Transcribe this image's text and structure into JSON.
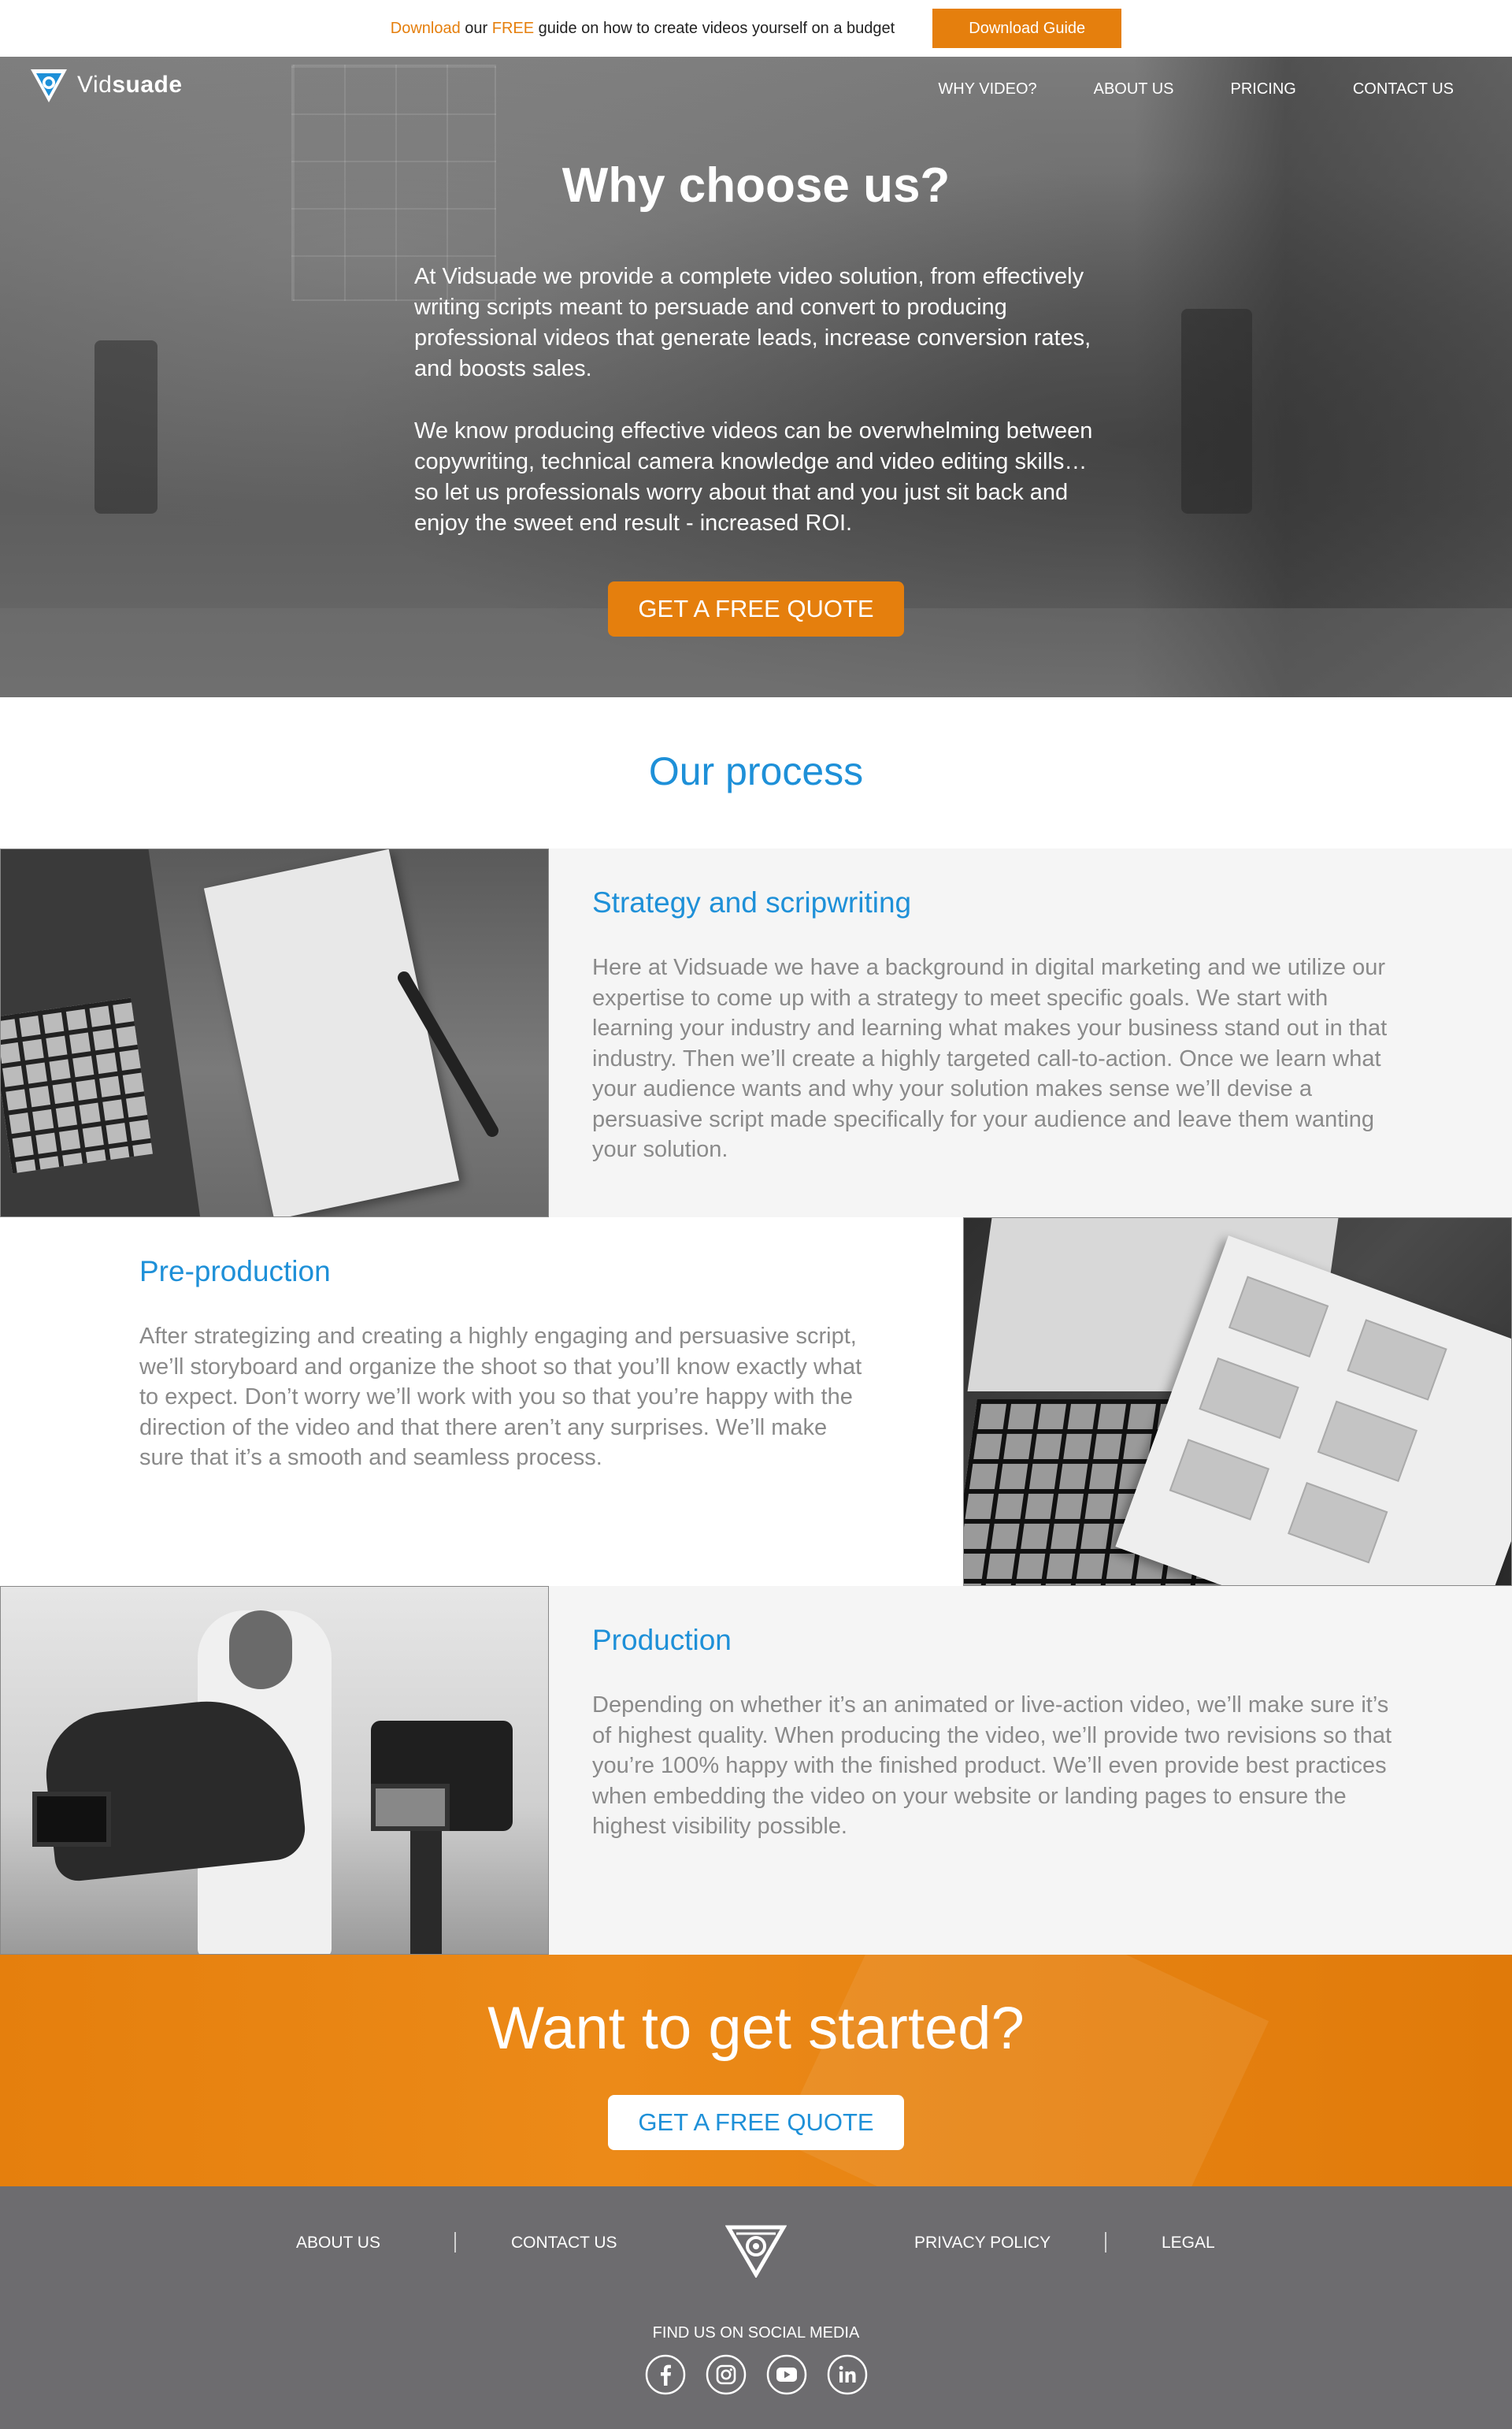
{
  "topbar": {
    "msg_download": "Download",
    "msg_our": " our ",
    "msg_free": "FREE",
    "msg_rest": " guide on how to create videos yourself on a budget",
    "button": "Download Guide"
  },
  "brand": {
    "name_light": "Vid",
    "name_bold": "suade"
  },
  "nav": {
    "items": [
      "WHY VIDEO?",
      "ABOUT US",
      "PRICING",
      "CONTACT US"
    ]
  },
  "hero": {
    "title": "Why choose us?",
    "paragraph1": "At Vidsuade we provide a complete video solution, from effectively writing scripts meant to persuade and convert to producing professional videos that generate leads, increase conversion rates, and boosts sales.",
    "paragraph2": "We know producing effective videos can be overwhelming between copywriting, technical camera knowledge and video editing skills…so let us professionals worry about that and you just sit back and enjoy the sweet end result - increased ROI.",
    "cta": "GET A FREE QUOTE"
  },
  "process": {
    "title": "Our process",
    "steps": [
      {
        "title": "Strategy and scripwriting",
        "body": "Here at Vidsuade we have a background in digital marketing and we utilize our expertise to come up with a strategy to meet specific goals. We start with learning your industry and learning what makes your business stand out in that industry. Then we’ll create a highly targeted call-to-action. Once we learn what your audience wants and why your solution makes sense we’ll devise a persuasive script made specifically for your audience and leave them wanting your solution."
      },
      {
        "title": "Pre-production",
        "body": "After strategizing and creating a highly engaging and persuasive script, we’ll storyboard and organize the shoot so that you’ll know exactly what to expect. Don’t worry we’ll work with you so that you’re happy with the direction of the video and that there aren’t any surprises. We’ll make sure that it’s a smooth and seamless process."
      },
      {
        "title": "Production",
        "body": "Depending on whether it’s an animated or live-action video, we’ll make sure it’s of highest quality. When producing the video, we’ll provide two revisions so that you’re 100% happy with the finished product. We’ll even provide best practices when embedding the video on your website or landing pages to ensure the highest visibility possible."
      }
    ]
  },
  "cta_band": {
    "title": "Want to get started?",
    "button": "GET A FREE QUOTE"
  },
  "footer": {
    "links": [
      "ABOUT US",
      "CONTACT US",
      "PRIVACY POLICY",
      "LEGAL"
    ],
    "social_title": "FIND US ON SOCIAL MEDIA",
    "social_icons": [
      "facebook-icon",
      "instagram-icon",
      "youtube-icon",
      "linkedin-icon"
    ]
  },
  "colors": {
    "accent_orange": "#e57f0d",
    "accent_blue": "#1e90d8",
    "footer_gray": "#6d6c6f",
    "panel_gray": "#f5f5f5"
  }
}
